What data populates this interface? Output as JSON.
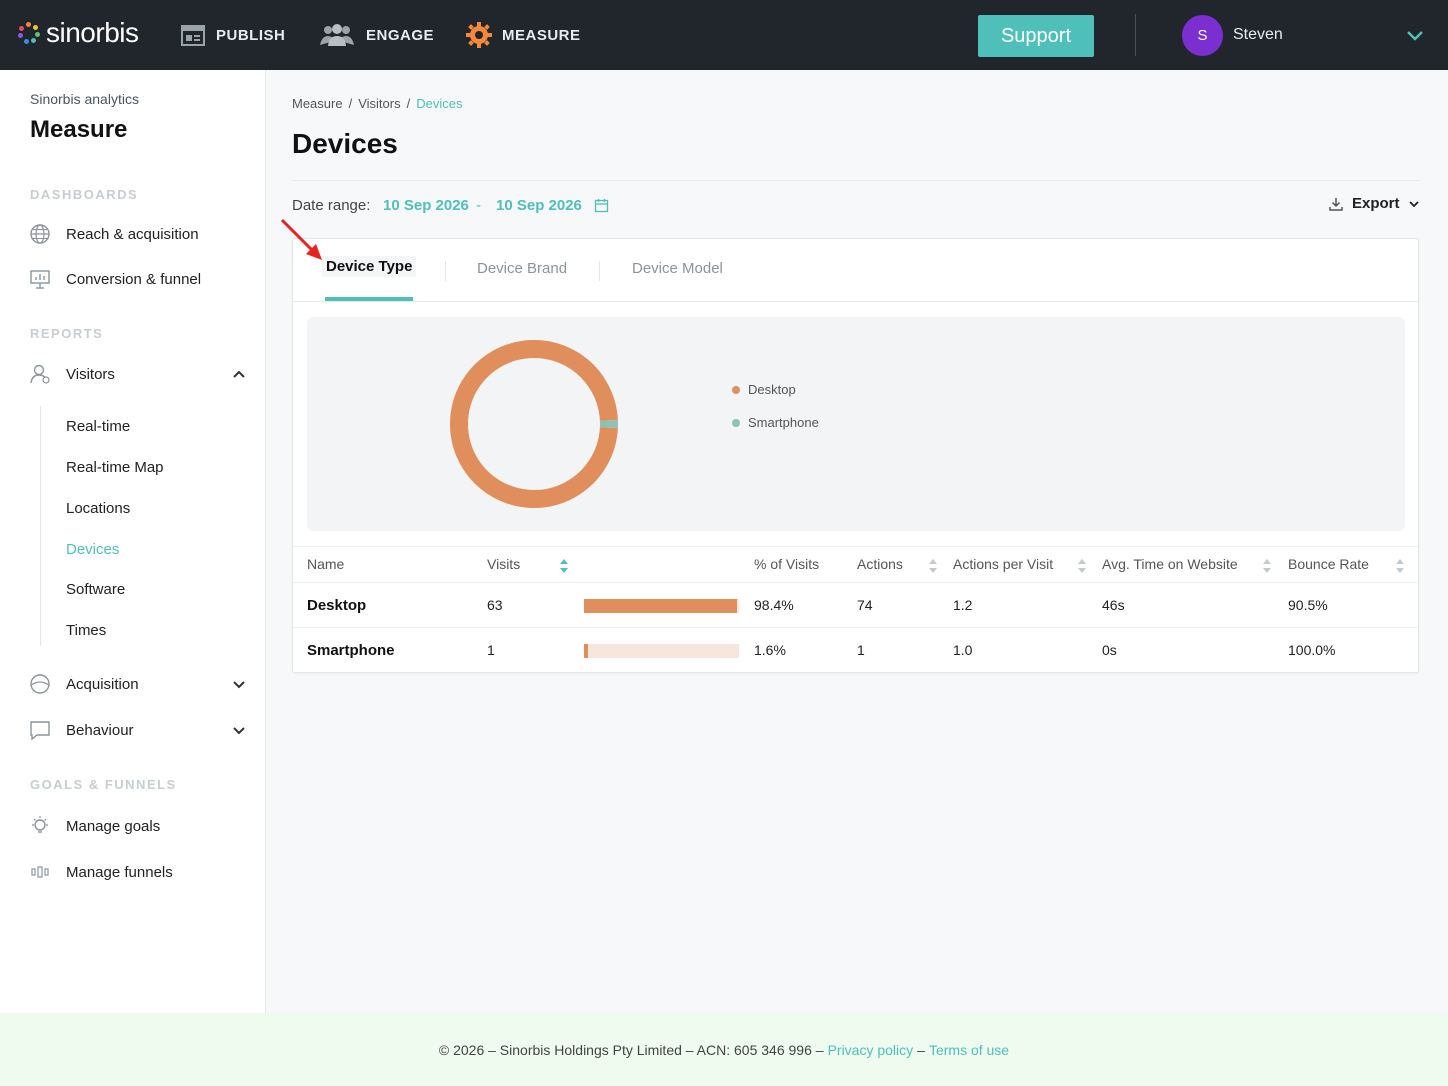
{
  "brand": {
    "name": "sinorbis"
  },
  "topnav": {
    "items": [
      {
        "label": "PUBLISH",
        "icon": "publish-icon"
      },
      {
        "label": "ENGAGE",
        "icon": "people-icon"
      },
      {
        "label": "MEASURE",
        "icon": "gear-icon"
      }
    ],
    "support_label": "Support",
    "user": {
      "initial": "S",
      "name": "Steven"
    },
    "colors": {
      "bg": "#20262c",
      "accent": "#4fbfba",
      "avatar": "#7b2fd0",
      "measure_icon": "#f5893b"
    }
  },
  "sidebar": {
    "subtitle": "Sinorbis analytics",
    "title": "Measure",
    "sections": {
      "dashboards": "DASHBOARDS",
      "reports": "REPORTS",
      "goals": "GOALS & FUNNELS"
    },
    "dashboards": [
      {
        "label": "Reach & acquisition",
        "icon": "globe-icon"
      },
      {
        "label": "Conversion & funnel",
        "icon": "presentation-icon"
      }
    ],
    "visitors": {
      "label": "Visitors",
      "icon": "user-icon"
    },
    "visitor_items": [
      {
        "label": "Real-time"
      },
      {
        "label": "Real-time Map"
      },
      {
        "label": "Locations"
      },
      {
        "label": "Devices",
        "active": true
      },
      {
        "label": "Software"
      },
      {
        "label": "Times"
      }
    ],
    "acquisition": {
      "label": "Acquisition",
      "icon": "globe-half-icon"
    },
    "behaviour": {
      "label": "Behaviour",
      "icon": "chat-icon"
    },
    "goals_items": [
      {
        "label": "Manage goals",
        "icon": "lightbulb-icon"
      },
      {
        "label": "Manage funnels",
        "icon": "funnel-icon"
      }
    ]
  },
  "breadcrumb": {
    "items": [
      "Measure",
      "Visitors",
      "Devices"
    ],
    "sep": "/"
  },
  "page": {
    "title": "Devices"
  },
  "date_range": {
    "label": "Date range:",
    "start": "10 Sep 2026",
    "dash": "-",
    "end": "10 Sep 2026"
  },
  "export": {
    "label": "Export"
  },
  "tabs": [
    {
      "label": "Device Type",
      "active": true
    },
    {
      "label": "Device Brand"
    },
    {
      "label": "Device Model"
    }
  ],
  "chart_data": {
    "type": "pie",
    "categories": [
      "Desktop",
      "Smartphone"
    ],
    "values": [
      63,
      1
    ],
    "colors": [
      "#e08f5c",
      "#8fc2b4"
    ],
    "legend": "right"
  },
  "table": {
    "headers": [
      "Name",
      "Visits",
      "% of Visits",
      "Actions",
      "Actions per Visit",
      "Avg. Time on Website",
      "Bounce Rate"
    ],
    "rows": [
      {
        "name": "Desktop",
        "visits": "63",
        "pct": "98.4%",
        "pct_value": 98.4,
        "actions": "74",
        "apv": "1.2",
        "avg_time": "46s",
        "bounce": "90.5%"
      },
      {
        "name": "Smartphone",
        "visits": "1",
        "pct": "1.6%",
        "pct_value": 1.6,
        "actions": "1",
        "apv": "1.0",
        "avg_time": "0s",
        "bounce": "100.0%"
      }
    ]
  },
  "footer": {
    "text": "© 2026 – Sinorbis Holdings Pty Limited – ACN: 605 346 996 –",
    "privacy": "Privacy policy",
    "dash": "–",
    "terms": "Terms of use"
  }
}
